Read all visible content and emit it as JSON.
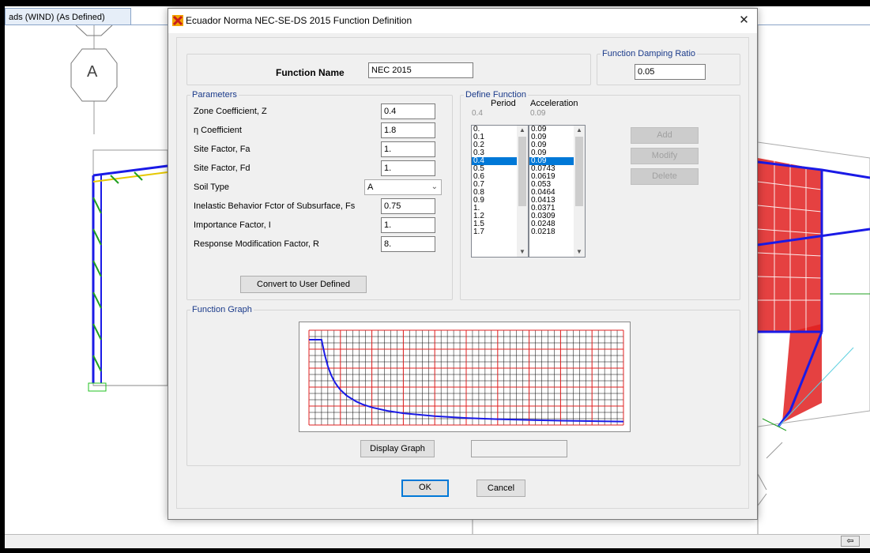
{
  "background": {
    "tab_title": "ads (WIND) (As Defined)",
    "node_label": "A",
    "nav_arrow": "⇦"
  },
  "dialog": {
    "title": "Ecuador Norma NEC-SE-DS 2015 Function Definition",
    "close_glyph": "✕",
    "function_name_label": "Function Name",
    "function_name_value": "NEC 2015",
    "damping": {
      "label": "Function Damping Ratio",
      "value": "0.05"
    },
    "parameters": {
      "label": "Parameters",
      "rows": [
        {
          "label": "Zone Coefficient, Z",
          "value": "0.4"
        },
        {
          "label": "η Coefficient",
          "value": "1.8"
        },
        {
          "label": "Site Factor, Fa",
          "value": "1."
        },
        {
          "label": "Site Factor, Fd",
          "value": "1."
        },
        {
          "label": "Soil Type",
          "value": "A"
        },
        {
          "label": "Inelastic Behavior Fctor of Subsurface, Fs",
          "value": "0.75"
        },
        {
          "label": "Importance Factor, I",
          "value": "1."
        },
        {
          "label": "Response Modification Factor, R",
          "value": "8."
        }
      ],
      "convert_button": "Convert to User Defined"
    },
    "define_function": {
      "label": "Define Function",
      "period_header": "Period",
      "acceleration_header": "Acceleration",
      "current_period": "0.4",
      "current_acceleration": "0.09",
      "periods": [
        "0.",
        "0.1",
        "0.2",
        "0.3",
        "0.4",
        "0.5",
        "0.6",
        "0.7",
        "0.8",
        "0.9",
        "1.",
        "1.2",
        "1.5",
        "1.7"
      ],
      "accelerations": [
        "0.09",
        "0.09",
        "0.09",
        "0.09",
        "0.09",
        "0.0743",
        "0.0619",
        "0.053",
        "0.0464",
        "0.0413",
        "0.0371",
        "0.0309",
        "0.0248",
        "0.0218"
      ],
      "selected_index": 4,
      "add_button": "Add",
      "modify_button": "Modify",
      "delete_button": "Delete"
    },
    "function_graph": {
      "label": "Function Graph",
      "display_button": "Display Graph",
      "status_text": ""
    },
    "ok_button": "OK",
    "cancel_button": "Cancel"
  },
  "chart_data": {
    "type": "line",
    "x": [
      0,
      0.1,
      0.2,
      0.3,
      0.4,
      0.5,
      0.6,
      0.7,
      0.8,
      0.9,
      1.0,
      1.2,
      1.5,
      1.7,
      2.0,
      2.5,
      3.0,
      4.0,
      5.0,
      6.0,
      7.0,
      8.0,
      10.0
    ],
    "y": [
      0.09,
      0.09,
      0.09,
      0.09,
      0.09,
      0.0743,
      0.0619,
      0.053,
      0.0464,
      0.0413,
      0.0371,
      0.0309,
      0.0248,
      0.0218,
      0.0186,
      0.0149,
      0.0124,
      0.0093,
      0.0074,
      0.0062,
      0.0053,
      0.0046,
      0.0037
    ],
    "xlim": [
      0,
      10
    ],
    "ylim": [
      0,
      0.1
    ],
    "grid": true,
    "colors": {
      "line": "#1a1ae6",
      "major_grid": "#e02020",
      "minor_grid": "#000000"
    }
  }
}
